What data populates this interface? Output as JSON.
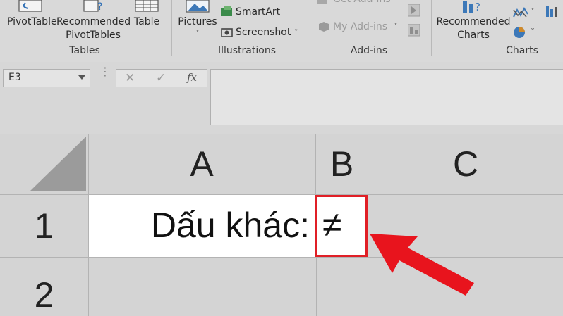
{
  "ribbon": {
    "tables": {
      "group_label": "Tables",
      "pivottable": "PivotTable",
      "recommended_pivottables_line1": "Recommended",
      "recommended_pivottables_line2": "PivotTables",
      "table": "Table"
    },
    "illustrations": {
      "group_label": "Illustrations",
      "pictures": "Pictures",
      "smartart": "SmartArt",
      "screenshot": "Screenshot"
    },
    "addins": {
      "group_label": "Add-ins",
      "get_addins": "Get Add-ins",
      "my_addins": "My Add-ins"
    },
    "charts": {
      "group_label": "Charts",
      "recommended_charts_line1": "Recommended",
      "recommended_charts_line2": "Charts"
    },
    "dropdown_glyph": "˅"
  },
  "formula_bar": {
    "name_box": "E3",
    "cancel_glyph": "✕",
    "enter_glyph": "✓",
    "function_glyph": "fx",
    "formula_value": ""
  },
  "sheet": {
    "columns": [
      "A",
      "B",
      "C"
    ],
    "rows": [
      "1",
      "2"
    ],
    "cells": {
      "A1": "Dấu khác:",
      "B1": "≠"
    }
  },
  "colors": {
    "highlight_border": "#e01f26",
    "arrow": "#e8141d",
    "ribbon_bg": "#d9d9d9",
    "grid_bg": "#d4d4d4"
  },
  "icons": [
    "pivottable-icon",
    "recommended-pivottables-icon",
    "table-icon",
    "pictures-icon",
    "smartart-icon",
    "screenshot-icon",
    "store-icon",
    "my-addins-icon",
    "bing-maps-icon",
    "people-graph-icon",
    "recommended-charts-icon",
    "line-chart-icon",
    "bar-chart-icon",
    "pie-chart-icon",
    "select-all-triangle-icon",
    "red-arrow-icon"
  ]
}
